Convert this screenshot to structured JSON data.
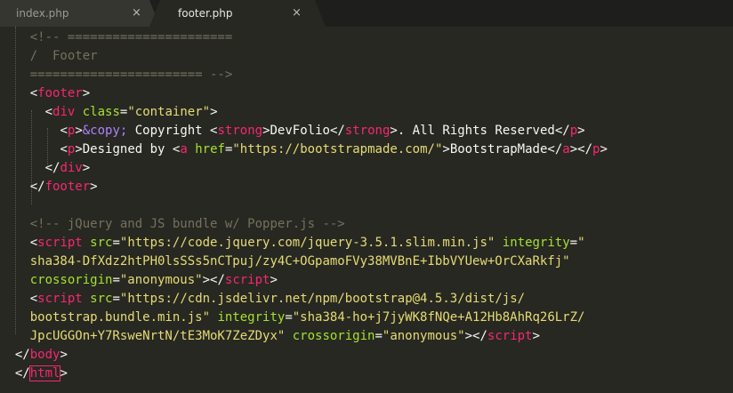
{
  "tabs": [
    {
      "label": "index.php",
      "close": "×",
      "active": false
    },
    {
      "label": "footer.php",
      "close": "×",
      "active": true
    }
  ],
  "editor": {
    "lines": [
      [
        "    ",
        "<!-- ====================== "
      ],
      [
        "    ",
        "/  Footer"
      ],
      [
        "    ",
        "======================= -->"
      ],
      [
        "    ",
        "<",
        "footer",
        ">"
      ],
      [
        "      ",
        "<",
        "div",
        " ",
        "class",
        "=",
        "\"container\"",
        ">"
      ],
      [
        "        ",
        "<",
        "p",
        ">",
        "&copy;",
        " Copyright ",
        "<",
        "strong",
        ">",
        "DevFolio",
        "</",
        "strong",
        ">",
        ". All Rights Reserved",
        "</",
        "p",
        ">"
      ],
      [
        "        ",
        "<",
        "p",
        ">",
        "Designed by ",
        "<",
        "a",
        " ",
        "href",
        "=",
        "\"https://bootstrapmade.com/\"",
        ">",
        "BootstrapMade",
        "</",
        "a",
        ">",
        "</",
        "p",
        ">"
      ],
      [
        "      ",
        "</",
        "div",
        ">"
      ],
      [
        "    ",
        "</",
        "footer",
        ">"
      ],
      [
        ""
      ],
      [
        "    ",
        "<!-- jQuery and JS bundle w/ Popper.js -->"
      ],
      [
        "    ",
        "<",
        "script",
        " ",
        "src",
        "=",
        "\"https://code.jquery.com/jquery-3.5.1.slim.min.js\"",
        " ",
        "integrity",
        "=",
        "\""
      ],
      [
        "    ",
        "sha384-DfXdz2htPH0lsSSs5nCTpuj/zy4C+OGpamoFVy38MVBnE+IbbVYUew+OrCXaRkfj\""
      ],
      [
        "    ",
        "crossorigin",
        "=",
        "\"anonymous\"",
        "></",
        "script",
        ">"
      ],
      [
        "    ",
        "<",
        "script",
        " ",
        "src",
        "=",
        "\"https://cdn.jsdelivr.net/npm/bootstrap@4.5.3/dist/js/"
      ],
      [
        "    ",
        "bootstrap.bundle.min.js\"",
        " ",
        "integrity",
        "=",
        "\"sha384-ho+j7jyWK8fNQe+A12Hb8AhRq26LrZ/"
      ],
      [
        "    ",
        "JpcUGGOn+Y7RsweNrtN/tE3MoK7ZeZDyx\"",
        " ",
        "crossorigin",
        "=",
        "\"anonymous\"",
        "></",
        "script",
        ">"
      ],
      [
        "  ",
        "</",
        "body",
        ">"
      ],
      [
        "  ",
        "</",
        "html",
        ">"
      ]
    ]
  },
  "colors": {
    "background": "#272822",
    "comment": "#75715e",
    "tag": "#f92672",
    "attribute": "#a6e22e",
    "string": "#e6db74",
    "entity": "#ae81ff",
    "text": "#f8f8f2"
  }
}
